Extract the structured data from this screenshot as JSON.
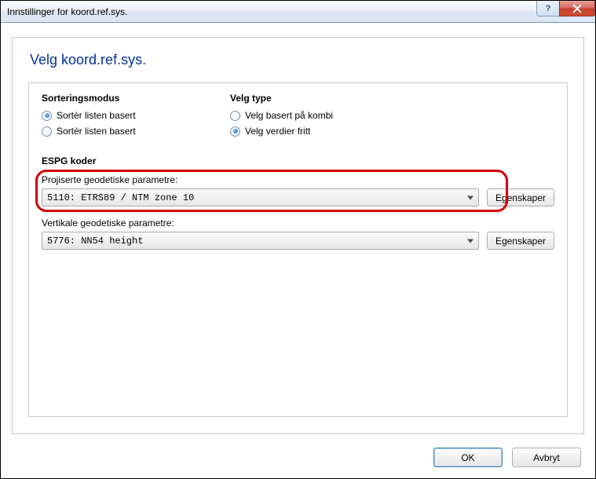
{
  "window": {
    "title": "Innstillinger for koord.ref.sys."
  },
  "page": {
    "heading": "Velg koord.ref.sys."
  },
  "sort_mode": {
    "title": "Sorteringsmodus",
    "opt1": "Sortèr listen basert",
    "opt2": "Sortèr listen basert"
  },
  "type_mode": {
    "title": "Velg type",
    "opt1": "Velg basert på kombi",
    "opt2": "Velg verdier fritt"
  },
  "espg": {
    "title": "ESPG koder",
    "proj_label": "Projiserte geodetiske parametre:",
    "proj_value": "5110: ETRS89 / NTM zone 10",
    "proj_btn": "Egenskaper",
    "vert_label": "Vertikale geodetiske parametre:",
    "vert_value": "5776: NN54 height",
    "vert_btn": "Egenskaper"
  },
  "footer": {
    "ok": "OK",
    "cancel": "Avbryt"
  }
}
